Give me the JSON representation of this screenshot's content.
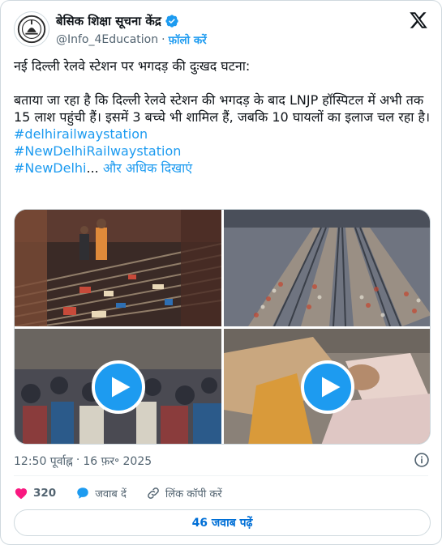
{
  "account": {
    "display_name": "बेसिक शिक्षा सूचना केंद्र",
    "handle": "@Info_4Education",
    "separator": "·",
    "follow_label": "फ़ॉलो करें",
    "verified_color": "#1d9bf0"
  },
  "icons": {
    "verified": "verified-badge-icon",
    "x_logo": "x-logo-icon",
    "info": "info-icon",
    "like": "heart-icon",
    "reply": "speech-bubble-icon",
    "copy_link": "link-icon",
    "play": "play-icon"
  },
  "tweet": {
    "headline": "नई दिल्ली रेलवे स्टेशन पर भगदड़ की दुःखद घटना:",
    "paragraph": "बताया जा रहा है कि दिल्ली रेलवे स्टेशन की भगदड़ के बाद LNJP हॉस्पिटल में अभी तक 15 लाश पहुंची हैं। इसमें 3 बच्चे भी शामिल हैं, जबकि 10 घायलों का इलाज चल रहा है।",
    "hashtag_1": "#delhirailwaystation",
    "hashtag_2": "#NewDelhiRailwaystation",
    "hashtag_3": "#NewDelhi",
    "ellipsis": "...",
    "show_more": "और अधिक दिखाएं"
  },
  "media": {
    "count": 4,
    "video_tiles": [
      3,
      4
    ]
  },
  "meta": {
    "time": "12:50 पूर्वाह्न",
    "dot": "·",
    "date": "16 फ़र॰ 2025"
  },
  "actions": {
    "like_count": "320",
    "reply_label": "जवाब दें",
    "copy_label": "लिंक कॉपी करें"
  },
  "footer": {
    "replies_button": "46 जवाब पढ़ें"
  },
  "colors": {
    "accent": "#1d9bf0",
    "like": "#f91880",
    "text_secondary": "#536471",
    "border": "#cfd9de"
  }
}
